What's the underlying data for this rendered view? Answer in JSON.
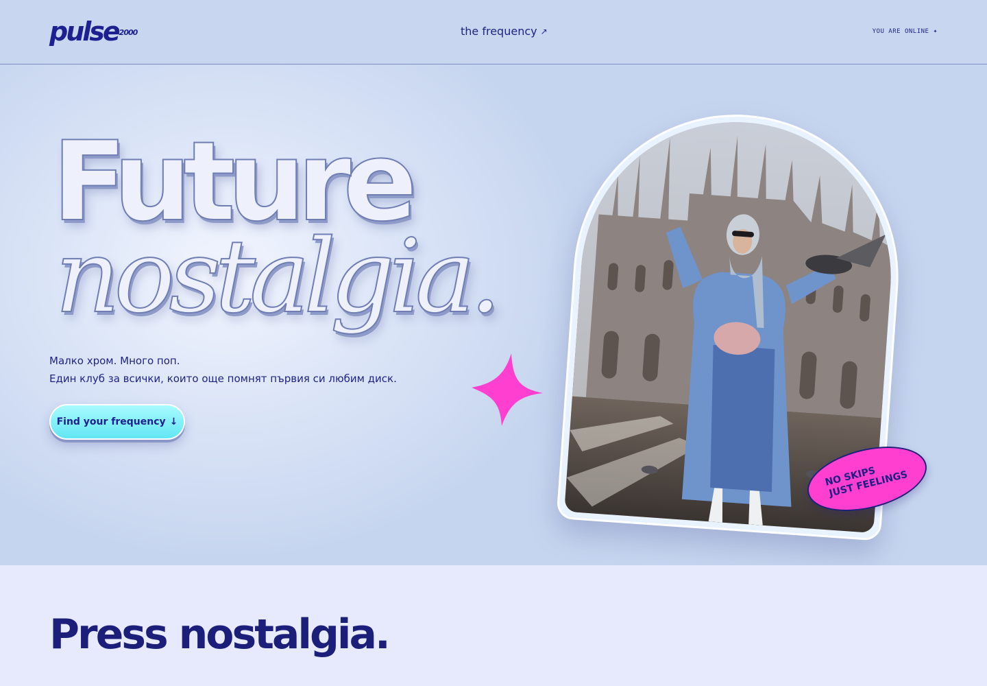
{
  "header": {
    "logo_text": "pulse",
    "logo_superscript": "2000",
    "nav_link": "the frequency",
    "nav_link_arrow": "↗",
    "status_text": "YOU ARE ONLINE",
    "status_icon": "✦"
  },
  "hero": {
    "title_line1": "Future",
    "title_line2": "nostalgia.",
    "lede_line1": "Малко хром. Много поп.",
    "lede_line2": "Един клуб за всички, които още помнят първия си любим диск.",
    "cta_label": "Find your frequency",
    "cta_arrow": "↓",
    "sparkle_icon": "four-point-star",
    "sparkle_color": "#ff3fd0",
    "photo_icon": "photo-woman-in-blue-coat-cathedral",
    "badge_line1": "NO SKIPS",
    "badge_line2": "JUST FEELINGS"
  },
  "lower": {
    "title": "Press nostalgia."
  },
  "colors": {
    "brand_navy": "#1d2090",
    "cta_cyan": "#62e6f4",
    "accent_pink": "#ff3fd0",
    "hero_bg": "#c6d5ef",
    "lower_bg": "#e6eafc"
  }
}
